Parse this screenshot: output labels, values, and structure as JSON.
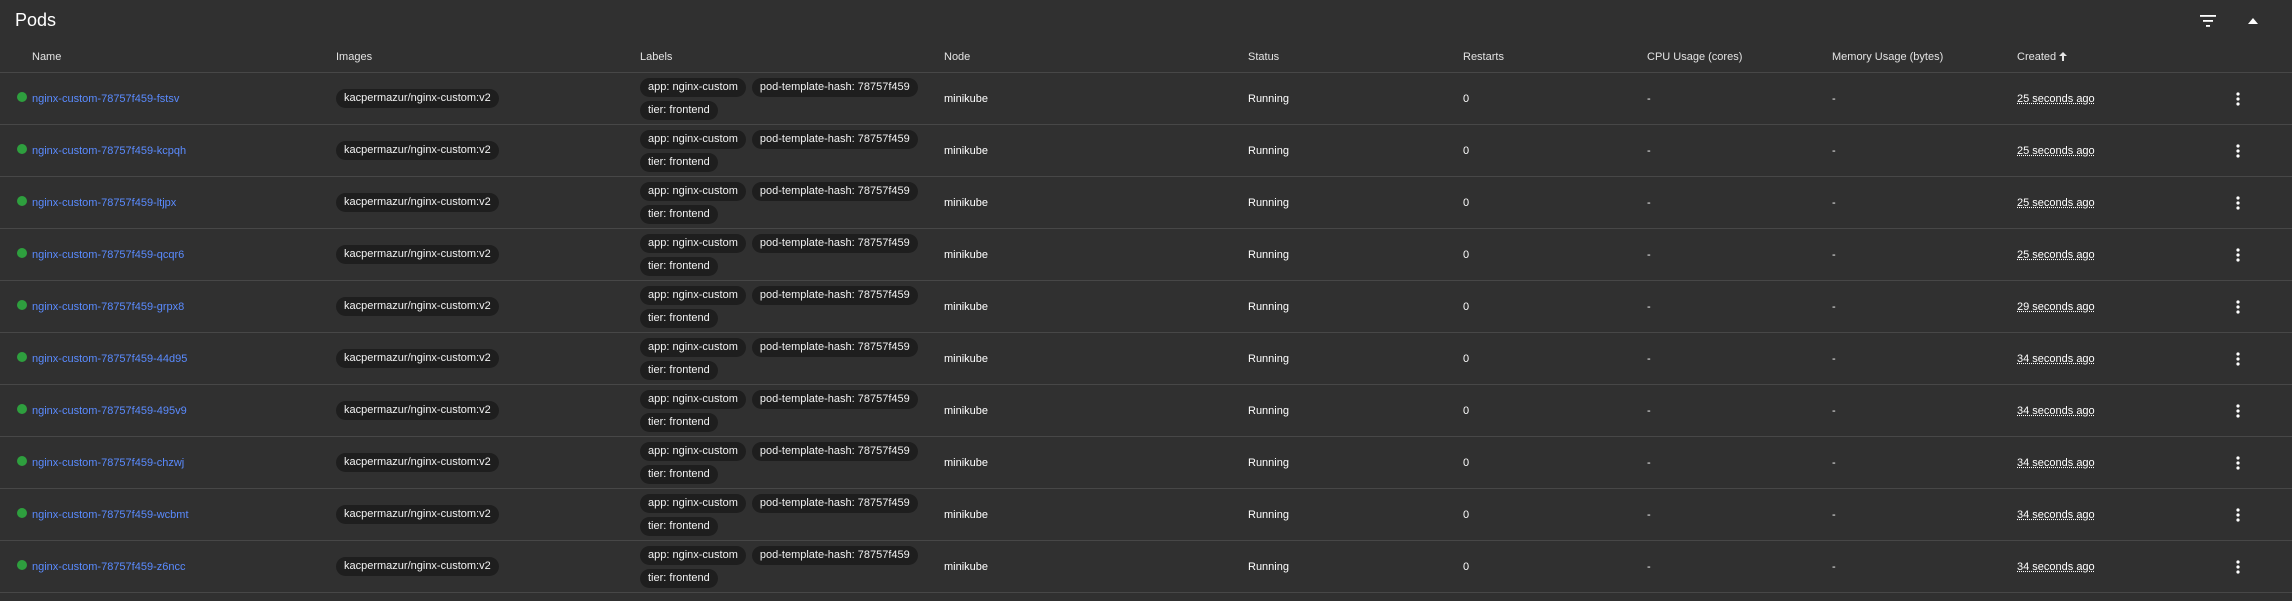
{
  "panel": {
    "title": "Pods"
  },
  "icons": {
    "filter": "filter-icon",
    "collapse": "chevron-up-icon",
    "status": "status-running-dot-icon",
    "sort": "arrow-up-icon",
    "menu": "more-vert-icon"
  },
  "colors": {
    "background": "#303030",
    "link": "#5a8bff",
    "status_running": "#2e9f3e",
    "chip_bg": "#1e1e1e",
    "divider": "#474747"
  },
  "columns": {
    "name": "Name",
    "images": "Images",
    "labels": "Labels",
    "node": "Node",
    "status": "Status",
    "restarts": "Restarts",
    "cpu": "CPU Usage (cores)",
    "memory": "Memory Usage (bytes)",
    "created": "Created"
  },
  "rows": [
    {
      "name": "nginx-custom-78757f459-fstsv",
      "image": "kacpermazur/nginx-custom:v2",
      "labels": [
        "app: nginx-custom",
        "pod-template-hash: 78757f459",
        "tier: frontend"
      ],
      "node": "minikube",
      "status": "Running",
      "restarts": "0",
      "cpu": "-",
      "memory": "-",
      "created": "25 seconds ago"
    },
    {
      "name": "nginx-custom-78757f459-kcpqh",
      "image": "kacpermazur/nginx-custom:v2",
      "labels": [
        "app: nginx-custom",
        "pod-template-hash: 78757f459",
        "tier: frontend"
      ],
      "node": "minikube",
      "status": "Running",
      "restarts": "0",
      "cpu": "-",
      "memory": "-",
      "created": "25 seconds ago"
    },
    {
      "name": "nginx-custom-78757f459-ltjpx",
      "image": "kacpermazur/nginx-custom:v2",
      "labels": [
        "app: nginx-custom",
        "pod-template-hash: 78757f459",
        "tier: frontend"
      ],
      "node": "minikube",
      "status": "Running",
      "restarts": "0",
      "cpu": "-",
      "memory": "-",
      "created": "25 seconds ago"
    },
    {
      "name": "nginx-custom-78757f459-qcqr6",
      "image": "kacpermazur/nginx-custom:v2",
      "labels": [
        "app: nginx-custom",
        "pod-template-hash: 78757f459",
        "tier: frontend"
      ],
      "node": "minikube",
      "status": "Running",
      "restarts": "0",
      "cpu": "-",
      "memory": "-",
      "created": "25 seconds ago"
    },
    {
      "name": "nginx-custom-78757f459-grpx8",
      "image": "kacpermazur/nginx-custom:v2",
      "labels": [
        "app: nginx-custom",
        "pod-template-hash: 78757f459",
        "tier: frontend"
      ],
      "node": "minikube",
      "status": "Running",
      "restarts": "0",
      "cpu": "-",
      "memory": "-",
      "created": "29 seconds ago"
    },
    {
      "name": "nginx-custom-78757f459-44d95",
      "image": "kacpermazur/nginx-custom:v2",
      "labels": [
        "app: nginx-custom",
        "pod-template-hash: 78757f459",
        "tier: frontend"
      ],
      "node": "minikube",
      "status": "Running",
      "restarts": "0",
      "cpu": "-",
      "memory": "-",
      "created": "34 seconds ago"
    },
    {
      "name": "nginx-custom-78757f459-495v9",
      "image": "kacpermazur/nginx-custom:v2",
      "labels": [
        "app: nginx-custom",
        "pod-template-hash: 78757f459",
        "tier: frontend"
      ],
      "node": "minikube",
      "status": "Running",
      "restarts": "0",
      "cpu": "-",
      "memory": "-",
      "created": "34 seconds ago"
    },
    {
      "name": "nginx-custom-78757f459-chzwj",
      "image": "kacpermazur/nginx-custom:v2",
      "labels": [
        "app: nginx-custom",
        "pod-template-hash: 78757f459",
        "tier: frontend"
      ],
      "node": "minikube",
      "status": "Running",
      "restarts": "0",
      "cpu": "-",
      "memory": "-",
      "created": "34 seconds ago"
    },
    {
      "name": "nginx-custom-78757f459-wcbmt",
      "image": "kacpermazur/nginx-custom:v2",
      "labels": [
        "app: nginx-custom",
        "pod-template-hash: 78757f459",
        "tier: frontend"
      ],
      "node": "minikube",
      "status": "Running",
      "restarts": "0",
      "cpu": "-",
      "memory": "-",
      "created": "34 seconds ago"
    },
    {
      "name": "nginx-custom-78757f459-z6ncc",
      "image": "kacpermazur/nginx-custom:v2",
      "labels": [
        "app: nginx-custom",
        "pod-template-hash: 78757f459",
        "tier: frontend"
      ],
      "node": "minikube",
      "status": "Running",
      "restarts": "0",
      "cpu": "-",
      "memory": "-",
      "created": "34 seconds ago"
    }
  ]
}
